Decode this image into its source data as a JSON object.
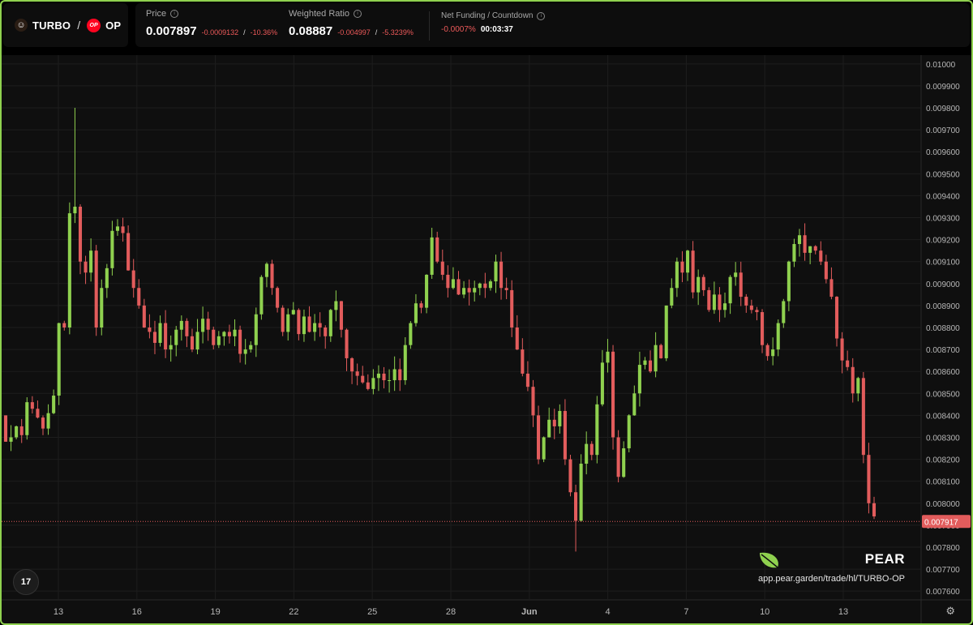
{
  "pair": {
    "base": "TURBO",
    "separator": "/",
    "quote": "OP",
    "quote_badge": "OP",
    "avatar_icon": "turbo-avatar-icon"
  },
  "stats": {
    "price": {
      "label": "Price",
      "value": "0.007897",
      "change": "-0.0009132",
      "separator": "/",
      "change_pct": "-10.36%"
    },
    "weighted_ratio": {
      "label": "Weighted Ratio",
      "value": "0.08887",
      "change": "-0.004997",
      "separator": "/",
      "change_pct": "-5.3239%"
    },
    "funding": {
      "label": "Net Funding / Countdown",
      "value": "-0.0007%",
      "countdown": "00:03:37"
    }
  },
  "colors": {
    "up": "#8fd14f",
    "down": "#e25c5c",
    "background": "#0f0f0f",
    "accent": "#8fd14f"
  },
  "chart_data": {
    "type": "candlestick",
    "x_ticks": [
      "13",
      "16",
      "19",
      "22",
      "25",
      "28",
      "Jun",
      "4",
      "7",
      "10",
      "13"
    ],
    "y_ticks": [
      "0.01000",
      "0.009900",
      "0.009800",
      "0.009700",
      "0.009600",
      "0.009500",
      "0.009400",
      "0.009300",
      "0.009200",
      "0.009100",
      "0.009000",
      "0.008900",
      "0.008800",
      "0.008700",
      "0.008600",
      "0.008500",
      "0.008400",
      "0.008300",
      "0.008200",
      "0.008100",
      "0.008000",
      "0.007900",
      "0.007800",
      "0.007700",
      "0.007600"
    ],
    "ylim": [
      0.00756,
      0.01004
    ],
    "last_price": "0.007917",
    "closes": [
      0.00828,
      0.0083,
      0.00835,
      0.00831,
      0.00846,
      0.00843,
      0.00839,
      0.00834,
      0.00841,
      0.00849,
      0.00882,
      0.0088,
      0.00932,
      0.00935,
      0.0091,
      0.00905,
      0.00915,
      0.0088,
      0.00898,
      0.00907,
      0.00924,
      0.00926,
      0.00923,
      0.00906,
      0.00898,
      0.0089,
      0.0088,
      0.00878,
      0.00873,
      0.00882,
      0.0087,
      0.00872,
      0.00879,
      0.00883,
      0.00876,
      0.0087,
      0.00878,
      0.00884,
      0.00879,
      0.00872,
      0.00876,
      0.00878,
      0.00876,
      0.00879,
      0.00868,
      0.0087,
      0.00872,
      0.00886,
      0.00903,
      0.00909,
      0.00898,
      0.00889,
      0.00878,
      0.00886,
      0.00888,
      0.00877,
      0.00885,
      0.00878,
      0.00882,
      0.0088,
      0.00876,
      0.00888,
      0.00892,
      0.00879,
      0.00866,
      0.0086,
      0.00858,
      0.00855,
      0.00852,
      0.00857,
      0.00859,
      0.00856,
      0.00856,
      0.00861,
      0.00856,
      0.00872,
      0.00882,
      0.00891,
      0.00889,
      0.00904,
      0.00921,
      0.0091,
      0.00904,
      0.00898,
      0.00902,
      0.00895,
      0.00898,
      0.00896,
      0.00898,
      0.009,
      0.00898,
      0.00901,
      0.0091,
      0.00898,
      0.00897,
      0.0088,
      0.0087,
      0.00859,
      0.00853,
      0.0084,
      0.0082,
      0.0083,
      0.00838,
      0.00835,
      0.00842,
      0.0082,
      0.00805,
      0.00792,
      0.00818,
      0.00827,
      0.00822,
      0.00845,
      0.00864,
      0.00869,
      0.0083,
      0.00812,
      0.00825,
      0.0084,
      0.0085,
      0.00863,
      0.00865,
      0.0086,
      0.00872,
      0.00866,
      0.0089,
      0.00898,
      0.0091,
      0.00905,
      0.00915,
      0.00896,
      0.00903,
      0.00897,
      0.00888,
      0.00895,
      0.00888,
      0.00891,
      0.00903,
      0.00905,
      0.00894,
      0.0089,
      0.00888,
      0.00887,
      0.00872,
      0.00867,
      0.0087,
      0.00882,
      0.00892,
      0.0091,
      0.00918,
      0.00922,
      0.00914,
      0.00917,
      0.00915,
      0.0091,
      0.00902,
      0.00894,
      0.00875,
      0.00865,
      0.00862,
      0.0085,
      0.00857,
      0.00822,
      0.008,
      0.00794
    ]
  },
  "watermark": {
    "brand": "PEAR",
    "url": "app.pear.garden/trade/hl/TURBO-OP",
    "logo_icon": "pear-leaf-icon"
  },
  "tv_logo": "17",
  "settings_icon": "gear-icon"
}
